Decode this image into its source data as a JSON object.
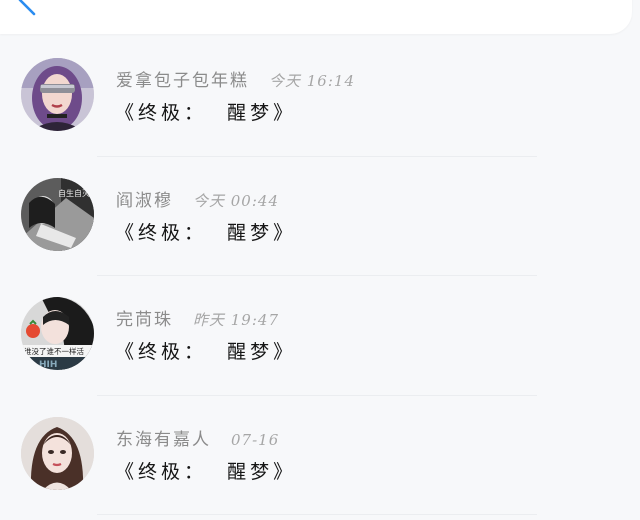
{
  "colors": {
    "back_icon": "#2a8cf0",
    "username": "#8b8b8b",
    "time": "#a6a6a6",
    "content": "#161616",
    "divider": "#ebedf0"
  },
  "header": {
    "back_icon": "back-arrow-icon"
  },
  "comments": [
    {
      "username": "爱拿包子包年糕",
      "time": "今天 16:14",
      "content": "《终极：  醒梦》",
      "avatar": "avatar-woman-sunglasses"
    },
    {
      "username": "阎淑穆",
      "time": "今天 00:44",
      "content": "《终极：  醒梦》",
      "avatar": "avatar-woman-monochrome"
    },
    {
      "username": "完苘珠",
      "time": "昨天 19:47",
      "content": "《终极：  醒梦》",
      "avatar": "avatar-girl-strawberry"
    },
    {
      "username": "东海有嘉人",
      "time": "07-16",
      "content": "《终极：  醒梦》",
      "avatar": "avatar-woman-portrait"
    }
  ],
  "avatar_text": {
    "monochrome": "自生自灭",
    "strawberry": "谁没了谁不一样活"
  }
}
